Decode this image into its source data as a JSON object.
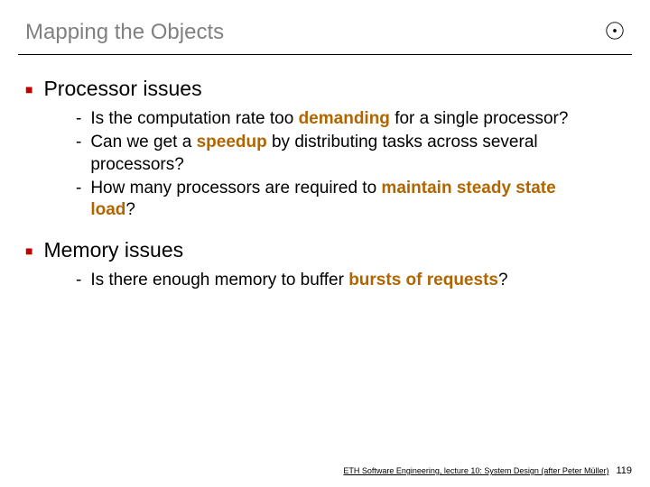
{
  "title": "Mapping the Objects",
  "sections": [
    {
      "heading": "Processor issues",
      "items": [
        {
          "pre": "Is the computation rate too ",
          "kw": "demanding",
          "post": " for a single processor?"
        },
        {
          "pre": "Can we get a ",
          "kw": "speedup",
          "post": " by distributing tasks across several processors?"
        },
        {
          "pre": "How many processors are required to ",
          "kw": "maintain steady state load",
          "post": "?"
        }
      ]
    },
    {
      "heading": "Memory issues",
      "items": [
        {
          "pre": "Is there enough memory to buffer ",
          "kw": "bursts of requests",
          "post": "?"
        }
      ]
    }
  ],
  "footer": "ETH Software Engineering, lecture 10: System Design (after Peter Müller)",
  "page": "119"
}
